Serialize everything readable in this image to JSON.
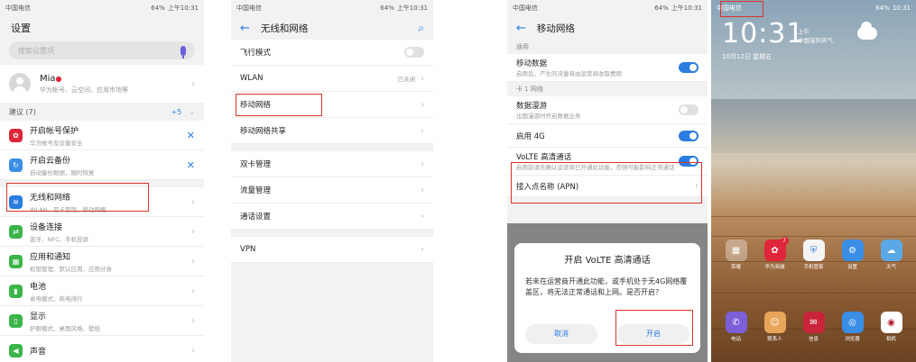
{
  "status": {
    "carrier": "中国电信",
    "battery": "64%",
    "time": "上午10:31",
    "time_short": "10:31"
  },
  "settings": {
    "title": "设置",
    "search_placeholder": "搜索设置项",
    "account": {
      "name": "Mia",
      "subtitle": "华为帐号、云空间、应用市场等"
    },
    "suggestions_label": "建议 (7)",
    "suggestions_count": "+5",
    "items": [
      {
        "title": "开启帐号保护",
        "subtitle": "华为帐号及设备安全"
      },
      {
        "title": "开启云备份",
        "subtitle": "自动备份数据，随时恢复"
      },
      {
        "title": "无线和网络",
        "subtitle": "WLAN、双卡管理、移动网络"
      },
      {
        "title": "设备连接",
        "subtitle": "蓝牙、NFC、手机投屏"
      },
      {
        "title": "应用和通知",
        "subtitle": "权限管理、默认应用、应用分身"
      },
      {
        "title": "电池",
        "subtitle": "省电模式、耗电排行"
      },
      {
        "title": "显示",
        "subtitle": "护眼模式、桌面风格、壁纸"
      },
      {
        "title": "声音",
        "subtitle": ""
      }
    ]
  },
  "wireless": {
    "title": "无线和网络",
    "airplane": "飞行模式",
    "wlan": "WLAN",
    "wlan_status": "已关闭",
    "mobile_network": "移动网络",
    "hotspot": "移动网络共享",
    "dual_sim": "双卡管理",
    "data_manage": "流量管理",
    "call_settings": "通话设置",
    "vpn": "VPN"
  },
  "mobile": {
    "title": "移动网络",
    "general_header": "通用",
    "mobile_data": {
      "title": "移动数据",
      "subtitle": "启用后，产生的流量将由运营商收取费用"
    },
    "card1_header": "卡 1 网络",
    "roaming": {
      "title": "数据漫游",
      "subtitle": "出国漫游时开启数据业务"
    },
    "enable_4g": "启用 4G",
    "volte": {
      "title": "VoLTE 高清通话",
      "subtitle": "启用前请先确认运营商已开通此功能，否则可能影响正常通话"
    },
    "apn": "接入点名称 (APN)",
    "dialog": {
      "title": "开启 VoLTE 高清通话",
      "body": "若未在运营商开通此功能，或手机处于无4G网络覆盖区，将无法正常通话和上网。是否开启？",
      "cancel": "取消",
      "confirm": "开启"
    }
  },
  "lockscreen": {
    "clock": "10:31",
    "clock_side": [
      "上午",
      "中国深圳天气"
    ],
    "date": "10月12日 星期五",
    "apps": [
      "荣耀",
      "华为商城",
      "手机管家",
      "设置",
      "天气"
    ],
    "dock": [
      "电话",
      "联系人",
      "信息",
      "浏览器",
      "相机"
    ]
  },
  "colors": {
    "accent": "#2a7de1",
    "highlight": "#d9342b"
  }
}
